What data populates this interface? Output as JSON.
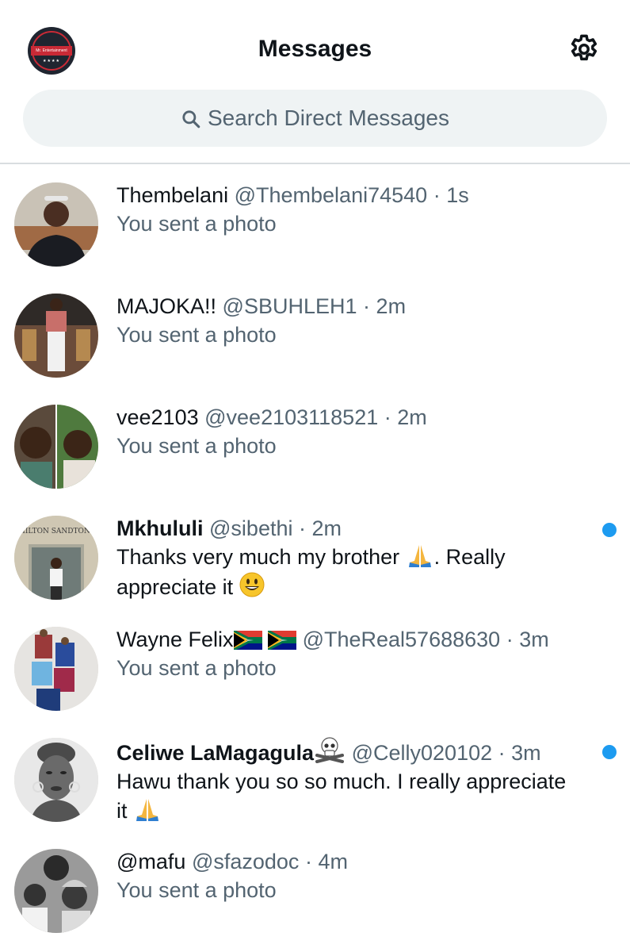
{
  "header": {
    "title": "Messages",
    "profile_avatar_text": "Mr. Entertainment",
    "profile_avatar_stars": "★★★★"
  },
  "search": {
    "placeholder": "Search Direct Messages"
  },
  "accent_color": "#1d9bf0",
  "conversations": [
    {
      "name": "Thembelani",
      "handle": "@Thembelani74540",
      "time": "1s",
      "preview": "You sent a photo",
      "unread": false
    },
    {
      "name": "MAJOKA!!",
      "handle": "@SBUHLEH1",
      "time": "2m",
      "preview": "You sent a photo",
      "unread": false
    },
    {
      "name": "vee2103",
      "handle": "@vee2103118521",
      "time": "2m",
      "preview": "You sent a photo",
      "unread": false
    },
    {
      "name": "Mkhululi",
      "handle": "@sibethi",
      "time": "2m",
      "preview_part1": "Thanks very much my brother ",
      "preview_part2": ". Really",
      "preview_line2": "appreciate it ",
      "unread": true,
      "avatar_sign": "HILTON SANDTON"
    },
    {
      "name": "Wayne Felix",
      "handle": "@TheReal57688630",
      "time": "3m",
      "preview": "You sent a photo",
      "unread": false,
      "name_emojis": [
        "south-africa-flag-icon",
        "south-africa-flag-icon"
      ]
    },
    {
      "name": "Celiwe LaMagagula",
      "handle": "@Celly020102",
      "time": "3m",
      "preview_line1": "Hawu thank you so so much. I really appreciate",
      "preview_line2": "it ",
      "unread": true,
      "name_emojis": [
        "skull-crossbones-icon"
      ]
    },
    {
      "name": "@mafu",
      "handle": "@sfazodoc",
      "time": "4m",
      "preview": "You sent a photo",
      "unread": false
    }
  ],
  "separator": "·"
}
